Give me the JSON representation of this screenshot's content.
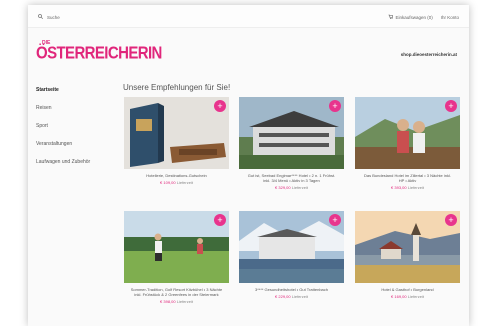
{
  "topbar": {
    "search_label": "Suche",
    "cart_label": "Einkaufswagen (0)",
    "account_label": "Ihr Konto"
  },
  "logo": {
    "small": "DIE",
    "big": "ÖSTERREICHERIN"
  },
  "site_url": "shop.dieoesterreicherin.at",
  "sidebar": {
    "items": [
      {
        "label": "Startseite",
        "active": true
      },
      {
        "label": "Reisen",
        "active": false
      },
      {
        "label": "Sport",
        "active": false
      },
      {
        "label": "Veranstaltungen",
        "active": false
      },
      {
        "label": "Laufwagen und Zubehör",
        "active": false
      }
    ]
  },
  "main": {
    "heading": "Unsere Empfehlungen für Sie!",
    "products": [
      {
        "title": "Hotellerie, Destinations-Gutschein",
        "price": "€ 109,00",
        "detail": "Lieferzeit"
      },
      {
        "title": "Gut ist, Seebad Englmar**** Hotel • 2 n. 1 Frühst. inkl. 3/4 Menü • Aktiv in 3 Tagen",
        "price": "€ 329,00",
        "detail": "Lieferzeit"
      },
      {
        "title": "Das Bundesland Hotel im Zillertal • 3 Nächte inkl. HP • Aktiv",
        "price": "€ 393,00",
        "detail": "Lieferzeit"
      },
      {
        "title": "Sommer-Tradition, Golf Resort Kitzbühel • 3 Nächte inkl. Frühstück & 2 Greenfees in der Steiermark",
        "price": "€ 398,00",
        "detail": "Lieferzeit"
      },
      {
        "title": "3**** Gesundheitshotel • Gut Trattenbach",
        "price": "€ 229,00",
        "detail": "Lieferzeit"
      },
      {
        "title": "Hotel & Gasthof • Burgenland",
        "price": "€ 169,00",
        "detail": "Lieferzeit"
      }
    ]
  },
  "colors": {
    "accent": "#e0267b",
    "plus_button": "#e8348d"
  },
  "icons": {
    "search": "search-icon",
    "cart": "cart-icon",
    "plus": "plus-icon"
  }
}
